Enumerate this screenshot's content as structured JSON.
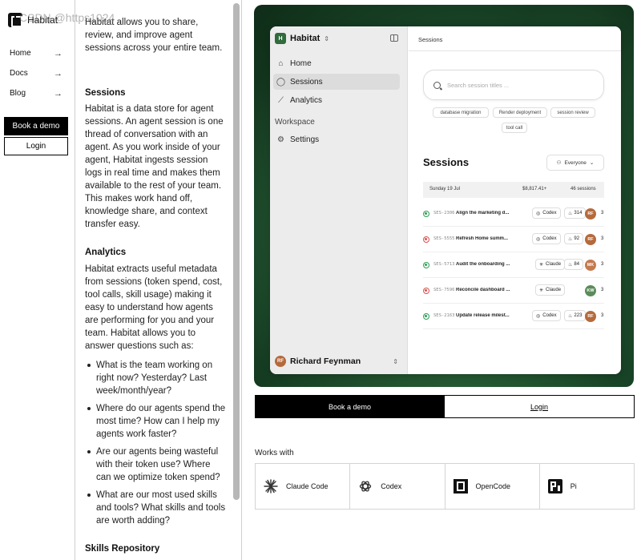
{
  "watermark": "CSDN @https1024",
  "nav": {
    "brand": "Habitat",
    "items": [
      {
        "label": "Home",
        "arrow": "→"
      },
      {
        "label": "Docs",
        "arrow": "→"
      },
      {
        "label": "Blog",
        "arrow": "→"
      }
    ],
    "book_demo": "Book a demo",
    "login": "Login"
  },
  "article": {
    "intro": "Habitat allows you to share, review, and improve agent sessions across your entire team.",
    "sessions_h": "Sessions",
    "sessions_p": "Habitat is a data store for agent sessions. An agent session is one thread of conversation with an agent. As you work inside of your agent, Habitat ingests session logs in real time and makes them available to the rest of your team. This makes work hand off, knowledge share, and context transfer easy.",
    "analytics_h": "Analytics",
    "analytics_p": "Habitat extracts useful metadata from sessions (token spend, cost, tool calls, skill usage) making it easy to understand how agents are performing for you and your team. Habitat allows you to answer questions such as:",
    "bullets": [
      "What is the team working on right now? Yesterday? Last week/month/year?",
      "Where do our agents spend the most time? How can I help my agents work faster?",
      "Are our agents being wasteful with their token use? Where can we optimize token spend?",
      "What are our most used skills and tools? What skills and tools are worth adding?"
    ],
    "skills_h": "Skills Repository"
  },
  "app": {
    "workspace": "Habitat",
    "workspace_initial": "H",
    "sidebar": [
      {
        "label": "Home",
        "icon": "home-icon"
      },
      {
        "label": "Sessions",
        "icon": "chat-icon"
      },
      {
        "label": "Analytics",
        "icon": "chart-icon"
      }
    ],
    "workspace_section": "Workspace",
    "settings": "Settings",
    "user": {
      "name": "Richard Feynman",
      "initials": "RF"
    },
    "breadcrumb": "Sessions",
    "search_placeholder": "Search session titles ...",
    "chips": [
      "database migration",
      "Render deployment",
      "session review",
      "tool call"
    ],
    "heading": "Sessions",
    "filter": "Everyone",
    "day": {
      "date": "Sunday 19 Jul",
      "tokens": "$8,817.41+",
      "count": "46 sessions"
    },
    "rows": [
      {
        "status": "ok",
        "id": "SES-2306",
        "title": "Align the marketing d...",
        "agent": "Codex",
        "tokens": "314",
        "initials": "RF",
        "avatar_color": "#b56a3c",
        "num": "3"
      },
      {
        "status": "err",
        "id": "SES-5555",
        "title": "Refresh Home summ...",
        "agent": "Codex",
        "tokens": "92",
        "initials": "RF",
        "avatar_color": "#b56a3c",
        "num": "3"
      },
      {
        "status": "ok",
        "id": "SES-5713",
        "title": "Audit the onboarding ...",
        "agent": "Claude",
        "tokens": "84",
        "initials": "MK",
        "avatar_color": "#c47a4e",
        "num": "3"
      },
      {
        "status": "err",
        "id": "SES-7596",
        "title": "Reconcile dashboard ...",
        "agent": "Claude",
        "tokens": "",
        "initials": "KW",
        "avatar_color": "#5b8c5a",
        "num": "3"
      },
      {
        "status": "ok",
        "id": "SES-2163",
        "title": "Update release milest...",
        "agent": "Codex",
        "tokens": "223",
        "initials": "RF",
        "avatar_color": "#b56a3c",
        "num": "3"
      }
    ]
  },
  "cta": {
    "book_demo": "Book a demo",
    "login": "Login"
  },
  "works_with": {
    "heading": "Works with",
    "items": [
      {
        "label": "Claude Code",
        "icon": "claude-icon"
      },
      {
        "label": "Codex",
        "icon": "openai-icon"
      },
      {
        "label": "OpenCode",
        "icon": "opencode-icon"
      },
      {
        "label": "Pi",
        "icon": "pi-icon"
      }
    ]
  }
}
